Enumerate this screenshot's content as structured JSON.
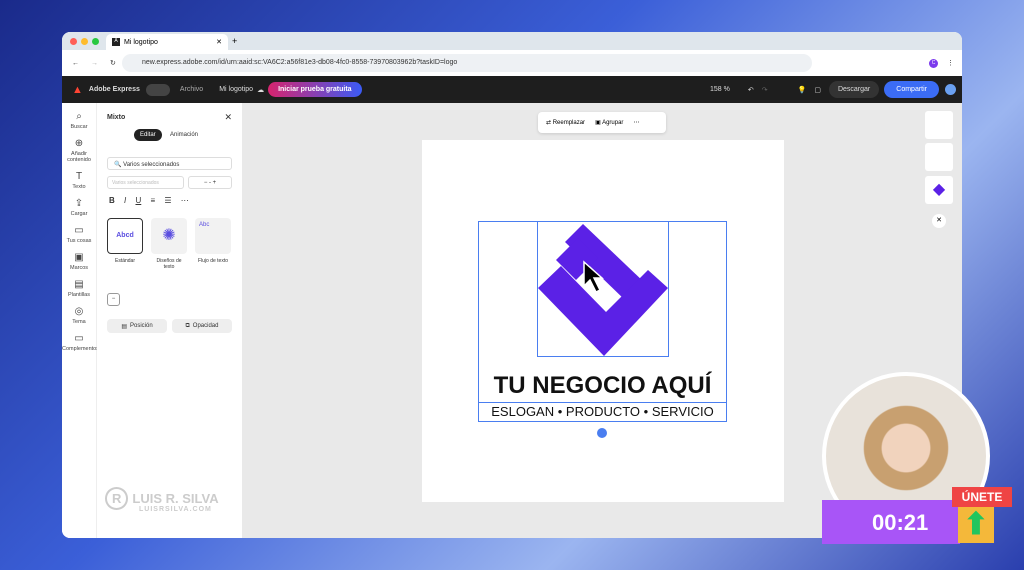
{
  "browser": {
    "tab_title": "Mi logotipo",
    "url": "new.express.adobe.com/id/urn:aaid:sc:VA6C2:a56f81e3-db08-4fc0-8558-73970803962b?taskID=logo",
    "profile_initial": "C"
  },
  "header": {
    "app_name": "Adobe Express",
    "file_menu": "Archivo",
    "doc_name": "Mi logotipo",
    "trial_button": "Iniciar prueba gratuita",
    "zoom": "158 %",
    "download": "Descargar",
    "share": "Compartir"
  },
  "rail": [
    {
      "icon": "search",
      "label": "Buscar"
    },
    {
      "icon": "plus",
      "label": "Añadir contenido"
    },
    {
      "icon": "text",
      "label": "Texto"
    },
    {
      "icon": "upload",
      "label": "Cargar"
    },
    {
      "icon": "folder",
      "label": "Tus cosas"
    },
    {
      "icon": "frame",
      "label": "Marcos"
    },
    {
      "icon": "template",
      "label": "Plantillas"
    },
    {
      "icon": "theme",
      "label": "Tema"
    },
    {
      "icon": "addons",
      "label": "Complementos"
    }
  ],
  "panel": {
    "title": "Mixto",
    "tabs": [
      "Editar",
      "Animación"
    ],
    "font_select": "Varios seleccionados",
    "size_select": "Varios seleccionados",
    "size_value": "-",
    "styles": [
      {
        "label": "Estándar",
        "preview": "Abcd"
      },
      {
        "label": "Diseños de texto",
        "preview": ""
      },
      {
        "label": "Flujo de texto",
        "preview": "Abc"
      }
    ],
    "position": "Posición",
    "opacity": "Opacidad"
  },
  "toolbar": {
    "replace": "Reemplazar",
    "group": "Agrupar"
  },
  "logo": {
    "title": "TU NEGOCIO AQUÍ",
    "slogan": "ESLOGAN • PRODUCTO • SERVICIO",
    "color": "#5b21e6"
  },
  "watermark": {
    "name": "LUIS R. SILVA",
    "site": "LUISRSILVA.COM"
  },
  "overlay": {
    "timer": "00:21",
    "join": "ÚNETE"
  }
}
